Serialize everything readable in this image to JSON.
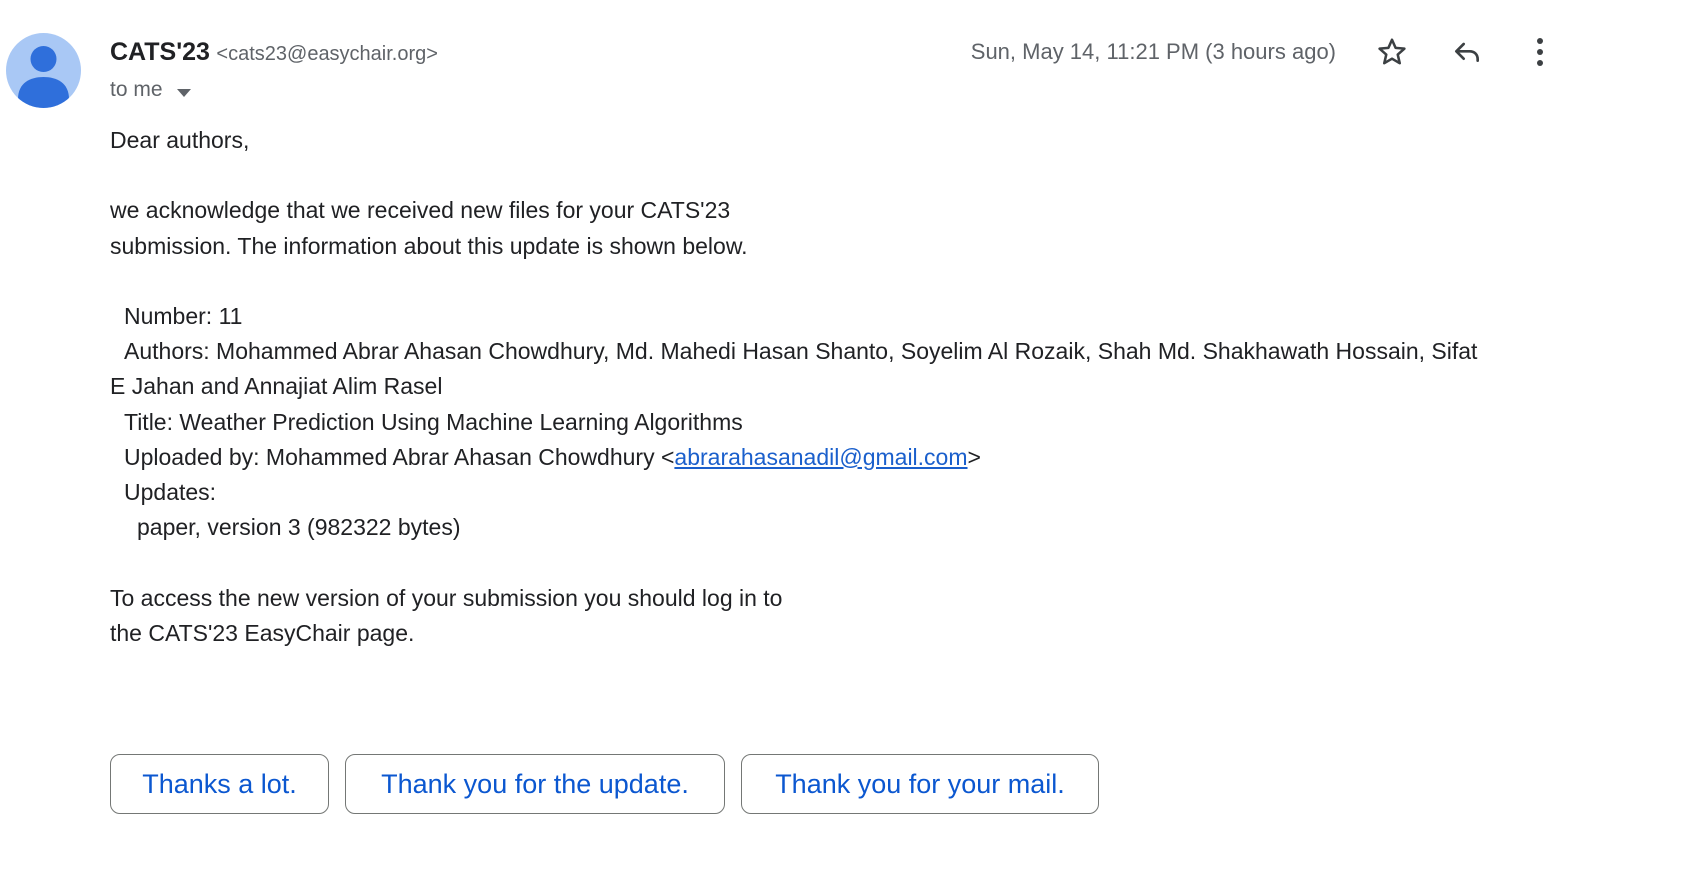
{
  "sender": {
    "name": "CATS'23",
    "email": "<cats23@easychair.org>"
  },
  "recipient_label": "to me",
  "date": "Sun, May 14, 11:21 PM (3 hours ago)",
  "icons": {
    "avatar": "person-avatar-icon",
    "recipient_caret": "caret-down-icon",
    "star": "star-outline-icon",
    "reply": "reply-arrow-icon",
    "more": "more-vertical-icon"
  },
  "colors": {
    "avatar_bg": "#a9c8f5",
    "avatar_fg": "#2f6fdb",
    "link": "#1a5fcc",
    "chip_text": "#0b57d0",
    "muted_text": "#5f6368"
  },
  "body": {
    "greeting": "Dear authors,",
    "para1_line1": "we acknowledge that we received new files for your CATS'23",
    "para1_line2": "submission. The information about this update is shown below.",
    "number": "Number: 11",
    "authors": "Authors: Mohammed Abrar Ahasan Chowdhury, Md. Mahedi Hasan Shanto, Soyelim Al Rozaik, Shah Md. Shakhawath Hossain, Sifat",
    "authors_cont": "E Jahan and Annajiat Alim Rasel",
    "title": "Title: Weather Prediction Using Machine Learning Algorithms",
    "uploaded_by_prefix": "Uploaded by: Mohammed Abrar Ahasan Chowdhury <",
    "uploaded_by_email": "abrarahasanadil@gmail.com",
    "uploaded_by_suffix": ">",
    "updates_label": "Updates:",
    "update_item": "paper, version 3 (982322 bytes)",
    "para2_line1": "To access the new version of your submission you should log in to",
    "para2_line2": "the CATS'23 EasyChair page."
  },
  "smart_replies": [
    "Thanks a lot.",
    "Thank you for the update.",
    "Thank you for your mail."
  ]
}
